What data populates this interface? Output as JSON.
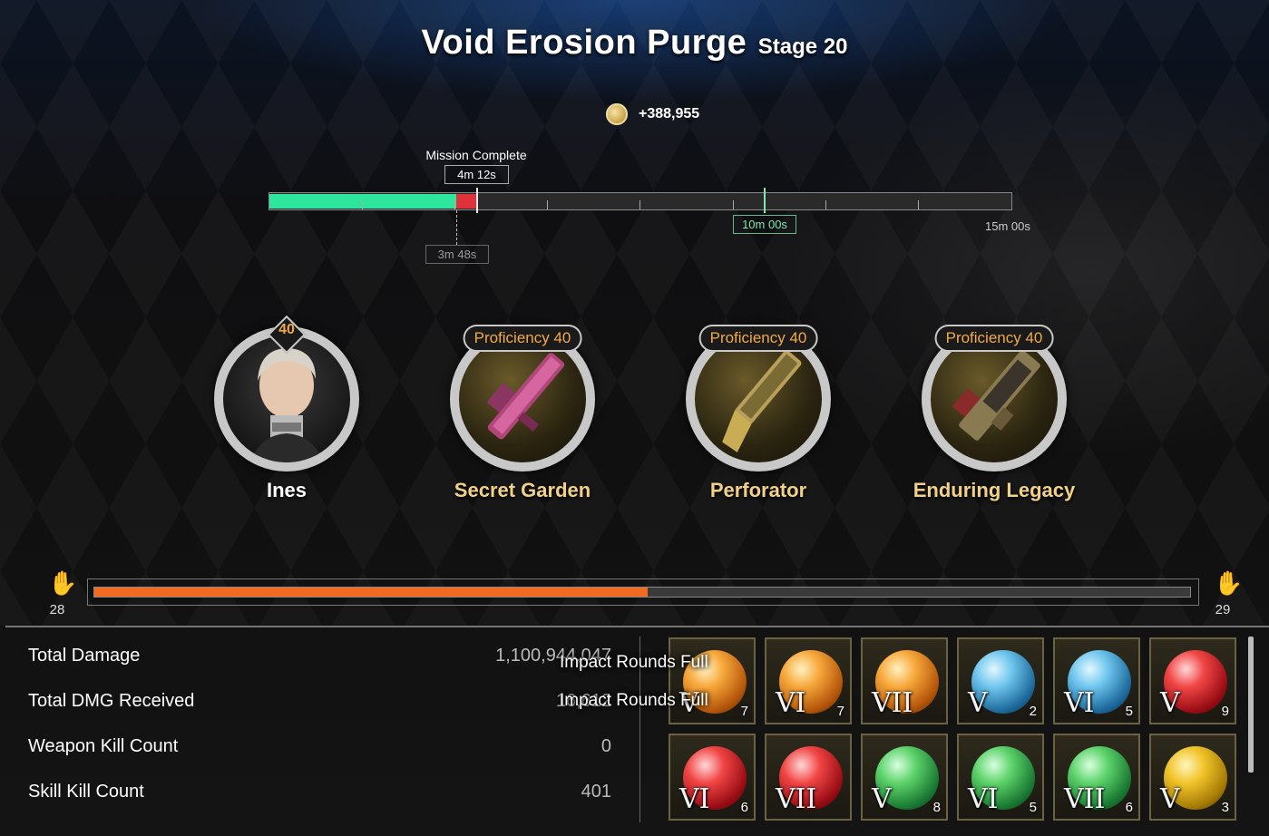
{
  "header": {
    "title": "Void Erosion Purge",
    "stage": "Stage 20"
  },
  "reward": {
    "icon": "gold-coin-icon",
    "amount": "+388,955"
  },
  "timeline": {
    "mission_label": "Mission Complete",
    "current_time": "4m 12s",
    "best_time": "3m 48s",
    "target_time": "10m 00s",
    "max_time": "15m 00s"
  },
  "portraits": [
    {
      "type": "character",
      "name": "Ines",
      "level": "40"
    },
    {
      "type": "weapon",
      "name": "Secret Garden",
      "proficiency_label": "Proficiency",
      "proficiency": "40"
    },
    {
      "type": "weapon",
      "name": "Perforator",
      "proficiency_label": "Proficiency",
      "proficiency": "40"
    },
    {
      "type": "weapon",
      "name": "Enduring Legacy",
      "proficiency_label": "Proficiency",
      "proficiency": "40"
    }
  ],
  "mastery": {
    "current_level": "28",
    "next_level": "29",
    "progress_fraction": 0.505,
    "icon": "hand-icon"
  },
  "stats": [
    {
      "label": "Total Damage",
      "value": "1,100,944,047"
    },
    {
      "label": "Total DMG Received",
      "value": "16,612"
    },
    {
      "label": "Weapon Kill Count",
      "value": "0"
    },
    {
      "label": "Skill Kill Count",
      "value": "401"
    }
  ],
  "toasts": [
    "Impact Rounds Full",
    "Impact Rounds Full"
  ],
  "modules": [
    {
      "tier": "V",
      "count": "7",
      "color": "orange"
    },
    {
      "tier": "VI",
      "count": "7",
      "color": "orange"
    },
    {
      "tier": "VII",
      "count": "",
      "color": "orange"
    },
    {
      "tier": "V",
      "count": "2",
      "color": "blue"
    },
    {
      "tier": "VI",
      "count": "5",
      "color": "blue"
    },
    {
      "tier": "V",
      "count": "9",
      "color": "red"
    },
    {
      "tier": "VI",
      "count": "6",
      "color": "red"
    },
    {
      "tier": "VII",
      "count": "",
      "color": "red"
    },
    {
      "tier": "V",
      "count": "8",
      "color": "green"
    },
    {
      "tier": "VI",
      "count": "5",
      "color": "green"
    },
    {
      "tier": "VII",
      "count": "6",
      "color": "green"
    },
    {
      "tier": "V",
      "count": "3",
      "color": "gold"
    }
  ]
}
